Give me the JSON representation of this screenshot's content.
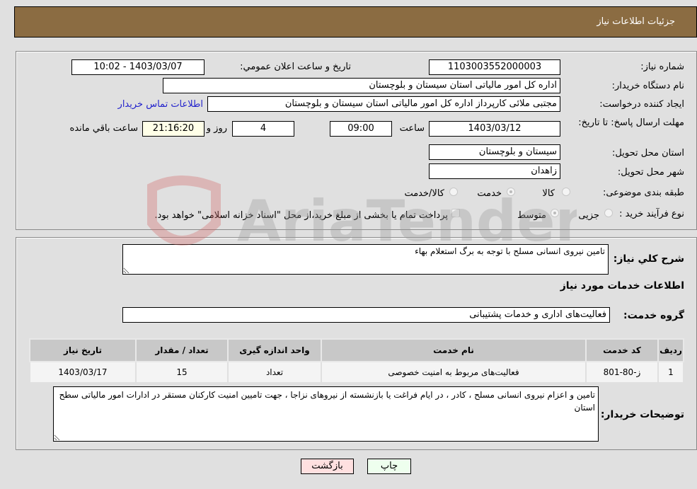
{
  "header": {
    "title": "جزئیات اطلاعات نیاز"
  },
  "fields": {
    "need_number_label": "شماره نیاز:",
    "need_number": "1103003552000003",
    "announce_label": "تاریخ و ساعت اعلان عمومي:",
    "announce_value": "1403/03/07 - 10:02",
    "buyer_org_label": "نام دستگاه خریدار:",
    "buyer_org": "اداره کل امور مالیاتی استان سیستان و بلوچستان",
    "creator_label": "ایجاد کننده درخواست:",
    "creator": "مجتبی ملائی کارپرداز اداره کل امور مالیاتی استان سیستان و بلوچستان",
    "contact_link": "اطلاعات تماس خریدار",
    "deadline_label": "مهلت ارسال پاسخ: تا تاریخ:",
    "deadline_date": "1403/03/12",
    "time_label": "ساعت",
    "deadline_time": "09:00",
    "days_value": "4",
    "days_label": "روز و",
    "remaining_time": "21:16:20",
    "remaining_label": "ساعت باقي مانده",
    "province_label": "استان محل تحویل:",
    "province": "سیستان و بلوچستان",
    "city_label": "شهر محل تحویل:",
    "city": "زاهدان",
    "category_label": "طبقه بندی موضوعی:",
    "category_options": [
      {
        "label": "کالا",
        "checked": false
      },
      {
        "label": "خدمت",
        "checked": true
      },
      {
        "label": "کالا/خدمت",
        "checked": false
      }
    ],
    "process_label": "نوع فرآیند خرید :",
    "process_options": [
      {
        "label": "جزیی",
        "checked": false
      },
      {
        "label": "متوسط",
        "checked": true
      }
    ],
    "treasury_note": "پرداخت تمام یا بخشی از مبلغ خرید،از محل \"اسناد خزانه اسلامی\" خواهد بود."
  },
  "details": {
    "summary_label": "شرح كلي نياز:",
    "summary": "تامین نیروی انسانی مسلح با توجه به برگ استعلام بهاء",
    "services_heading": "اطلاعات خدمات مورد نیاز",
    "service_group_label": "گروه خدمت:",
    "service_group": "فعالیت‌های اداری و خدمات پشتیبانی",
    "table": {
      "headers": [
        "ردیف",
        "کد خدمت",
        "نام خدمت",
        "واحد اندازه گیری",
        "تعداد / مقدار",
        "تاریخ نیاز"
      ],
      "rows": [
        [
          "1",
          "ز-80-801",
          "فعالیت‌های مربوط به امنیت خصوصی",
          "تعداد",
          "15",
          "1403/03/17"
        ]
      ]
    },
    "buyer_notes_label": "توضیحات خریدار:",
    "buyer_notes": "تامین و اعزام نیروی انسانی مسلح ، کادر ، در ایام فراغت یا بازنشسته از نیروهای نزاجا ، جهت تامیین امنیت کارکنان مستقر در ادارات امور مالیاتی سطح استان"
  },
  "buttons": {
    "print": "چاپ",
    "back": "بازگشت"
  },
  "watermark": "AriaTender.net"
}
